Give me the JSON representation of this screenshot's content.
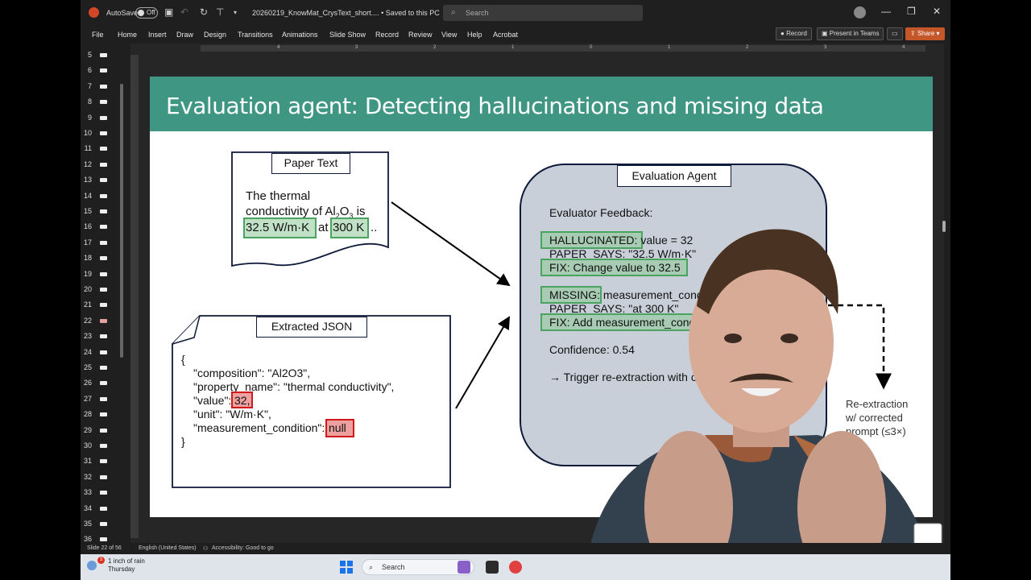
{
  "titlebar": {
    "autosave_label": "AutoSave",
    "autosave_state": "Off",
    "filename": "20260219_KnowMat_CrysText_short....  •  Saved to this PC ⌄",
    "search_placeholder": "Search"
  },
  "ribbon": {
    "tabs": [
      "File",
      "Home",
      "Insert",
      "Draw",
      "Design",
      "Transitions",
      "Animations",
      "Slide Show",
      "Record",
      "Review",
      "View",
      "Help",
      "Acrobat"
    ],
    "record_btn": "Record",
    "teams_btn": "Present in Teams",
    "share_btn": "Share"
  },
  "thumbnails": {
    "numbers": [
      "5",
      "6",
      "7",
      "8",
      "9",
      "10",
      "11",
      "12",
      "13",
      "14",
      "15",
      "16",
      "17",
      "18",
      "19",
      "20",
      "21",
      "22",
      "23",
      "24",
      "25",
      "26",
      "27",
      "28",
      "29",
      "30",
      "31",
      "32",
      "33",
      "34",
      "35",
      "36"
    ],
    "active": "22"
  },
  "ruler": [
    "4",
    "3",
    "2",
    "1",
    "0",
    "1",
    "2",
    "3",
    "4"
  ],
  "slide": {
    "title": "Evaluation agent: Detecting hallucinations and missing data",
    "paper_label": "Paper Text",
    "paper_line1": "The thermal",
    "paper_line2_a": "conductivity of Al",
    "paper_line2_sub1": "2",
    "paper_line2_b": "O",
    "paper_line2_sub2": "3",
    "paper_line2_c": " is",
    "paper_value": "32.5 W/m·K",
    "paper_at": "at",
    "paper_temp": "300 K",
    "paper_ellipsis": "..",
    "json_label": "Extracted JSON",
    "json_lines": [
      "{",
      "\"composition\": \"Al2O3\",",
      "\"property_name\": \"thermal conductivity\",",
      "\"value\":",
      "\"unit\": \"W/m·K\",",
      "\"measurement_condition\":",
      "}"
    ],
    "json_value_hl": "32,",
    "json_null_hl": "null",
    "agent_label": "Evaluation Agent",
    "feedback_title": "Evaluator Feedback:",
    "halluc_tag": "HALLUCINATED:",
    "halluc_text": " value = 32",
    "paper_says_1": "PAPER_SAYS: \"32.5 W/m·K\"",
    "fix_1": "FIX: Change value to 32.5",
    "missing_tag": "MISSING:",
    "missing_text": " measurement_cond",
    "paper_says_2": "PAPER_SAYS: \"at 300 K\"",
    "fix_2": "FIX: Add measurement_cond",
    "confidence": "Confidence: 0.54",
    "trigger": "→ Trigger re-extraction with co",
    "reextract_1": "Re-extraction",
    "reextract_2": "w/ corrected",
    "reextract_3": "prompt (≤3×)"
  },
  "status": {
    "slide": "Slide 22 of 56",
    "language": "English (United States)",
    "accessibility": "Accessibility: Good to go"
  },
  "taskbar": {
    "weather_line1": "1 inch of rain",
    "weather_line2": "Thursday",
    "badge": "3",
    "search": "Search"
  },
  "colors": {
    "slide_header": "#3f9683",
    "highlight_green": "#8cc896",
    "highlight_red": "#e67878",
    "agent_fill": "#c9cfd8"
  }
}
